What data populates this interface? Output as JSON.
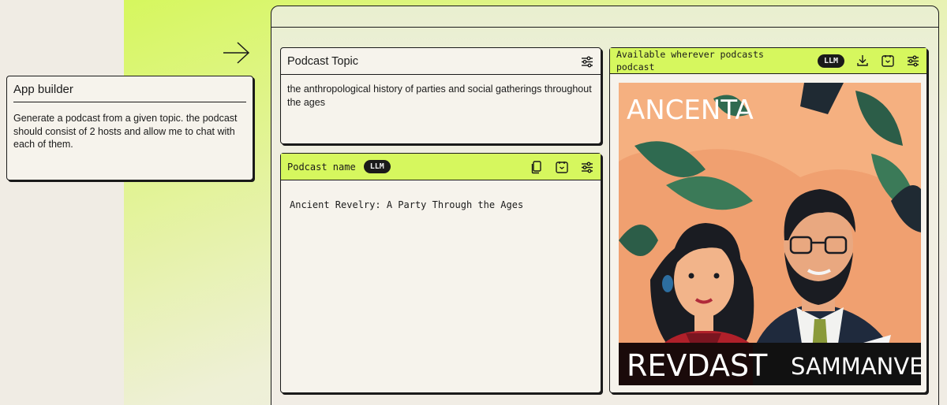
{
  "app_builder": {
    "title": "App builder",
    "description": "Generate a podcast from a given topic. the podcast should consist of 2 hosts and allow me to chat with each of them."
  },
  "topic_panel": {
    "title": "Podcast Topic",
    "value": "the anthropological history of parties and social gatherings throughout the ages"
  },
  "name_panel": {
    "title": "Podcast name",
    "badge": "LLM",
    "value": "Ancient Revelry: A Party Through the Ages"
  },
  "podcast_panel": {
    "title": "Available wherever podcasts podcast",
    "badge": "LLM",
    "cover_text": {
      "top": "ANCENTA",
      "bottom_left": "REVDAST",
      "bottom_right": "SAMMANVERY"
    }
  },
  "colors": {
    "accent_green": "#d6f75e",
    "panel_bg": "#f6f3ec",
    "page_bg": "#f0ece4",
    "ink": "#1a1a1a"
  },
  "icons": {
    "arrow": "arrow-right-icon",
    "settings": "sliders-icon",
    "copy": "copy-icon",
    "regenerate": "regenerate-icon",
    "download": "download-icon"
  }
}
